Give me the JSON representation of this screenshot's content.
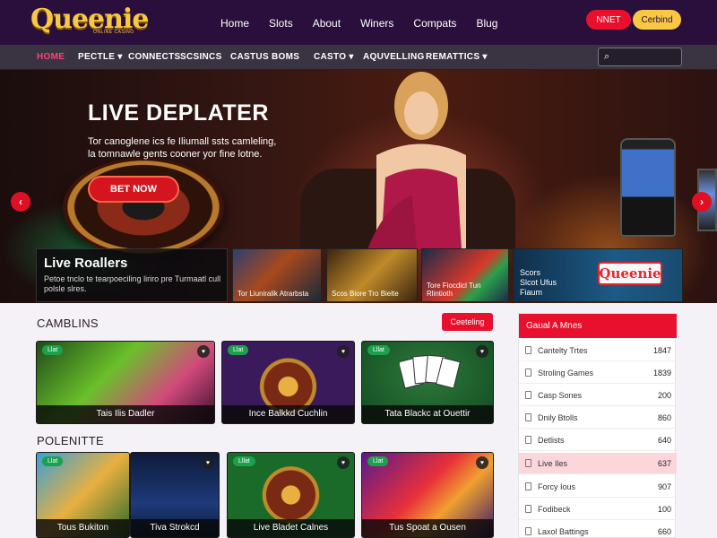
{
  "header": {
    "logo": "Queenie",
    "logo_tagline": "ONLINE CASINO",
    "nav": [
      "Home",
      "Slots",
      "About",
      "Winers",
      "Compats",
      "Blug"
    ],
    "join_button": "NNET",
    "login_button": "Cerbind"
  },
  "mainnav": {
    "items": [
      "HOME",
      "PECTLE ▾",
      "CONNECTS",
      "SCSINCS",
      "CASTUS",
      "BOMS",
      "CASTO ▾",
      "AQUVELLING",
      "REMATTICS ▾"
    ],
    "search_icon": "search-icon"
  },
  "hero": {
    "title": "LIVE DEPLATER",
    "subtitle_line1": "Tor canoglene ics fe Iliumall ssts camleling,",
    "subtitle_line2": "la tomnawle gents cooner yor fine lotne.",
    "cta": "BET NOW",
    "live_title": "Live Roallers",
    "live_desc": "Petoe tnclo te tearpoeciling liriro pre Turmaatl cull polsle slres.",
    "tiles": [
      {
        "caption": "Tor Liuniralik Atrarbsta"
      },
      {
        "caption": "Scos Biore Tro Bielte"
      },
      {
        "caption": "Tore Fiocdicl Tun Rlintioth"
      }
    ],
    "promo_title_1": "Scors",
    "promo_title_2": "Slcot Ufus",
    "promo_title_3": "Fiaum",
    "promo_logo": "Queenie",
    "prev_icon": "chevron-left-icon",
    "next_icon": "chevron-right-icon"
  },
  "sections": {
    "gambling_title": "CAMBLINS",
    "gambling_button": "Ceeteling",
    "gambling_cards": [
      {
        "caption": "Tais Ilis Dadler",
        "badge": "Llat"
      },
      {
        "caption": "Ince Balkkd Cuchlin",
        "badge": "Llat"
      },
      {
        "caption": "Tata Blackc at Ouettir",
        "badge": "Lllat"
      }
    ],
    "popular_title": "POLENITTE",
    "popular_cards": [
      {
        "caption": "Tous Bukiton",
        "badge": "Llat"
      },
      {
        "caption": "Tiva Strokcd",
        "badge": ""
      },
      {
        "caption": "Live Bladet Calnes",
        "badge": "Lllat"
      },
      {
        "caption": "Tus Spoat a Ousen",
        "badge": "Llat"
      }
    ]
  },
  "sidebar": {
    "title": "Gaual A Mnes",
    "rows": [
      {
        "name": "Cantelty Trtes",
        "count": "1847"
      },
      {
        "name": "Stroling Games",
        "count": "1839"
      },
      {
        "name": "Casp Sones",
        "count": "200"
      },
      {
        "name": "Dnily Btolls",
        "count": "860"
      },
      {
        "name": "Detlists",
        "count": "640"
      },
      {
        "name": "Live Iles",
        "count": "637"
      },
      {
        "name": "Forcy Ious",
        "count": "907"
      },
      {
        "name": "Fodibeck",
        "count": "100"
      },
      {
        "name": "Laxol Battings",
        "count": "660"
      }
    ]
  },
  "colors": {
    "brand_dark": "#2a0f3d",
    "accent_red": "#e8102c",
    "gold": "#f7c844"
  }
}
